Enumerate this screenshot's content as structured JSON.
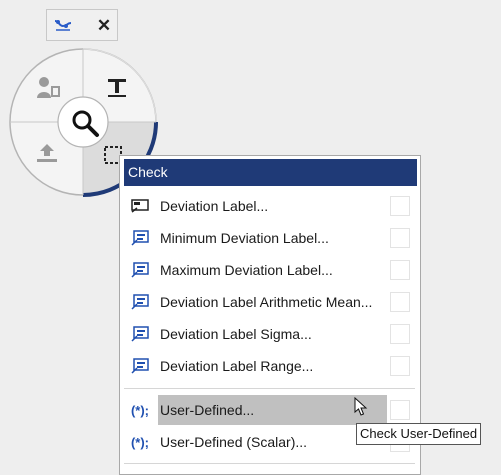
{
  "menu": {
    "header": "Check",
    "items": [
      {
        "label": "Deviation Label...",
        "icon": "deviation-label-icon"
      },
      {
        "label": "Minimum Deviation Label...",
        "icon": "min-deviation-label-icon"
      },
      {
        "label": "Maximum Deviation Label...",
        "icon": "max-deviation-label-icon"
      },
      {
        "label": "Deviation Label Arithmetic Mean...",
        "icon": "arithmetic-mean-label-icon"
      },
      {
        "label": "Deviation Label Sigma...",
        "icon": "sigma-label-icon"
      },
      {
        "label": "Deviation Label Range...",
        "icon": "range-label-icon"
      },
      {
        "label": "User-Defined...",
        "icon": "script-icon",
        "glyph": "(*);"
      },
      {
        "label": "User-Defined (Scalar)...",
        "icon": "script-icon",
        "glyph": "(*);"
      }
    ]
  },
  "tooltip": "Check User-Defined",
  "colors": {
    "accent": "#1f3a77",
    "icon_blue": "#2050b0",
    "hover": "#c0c0c0"
  }
}
